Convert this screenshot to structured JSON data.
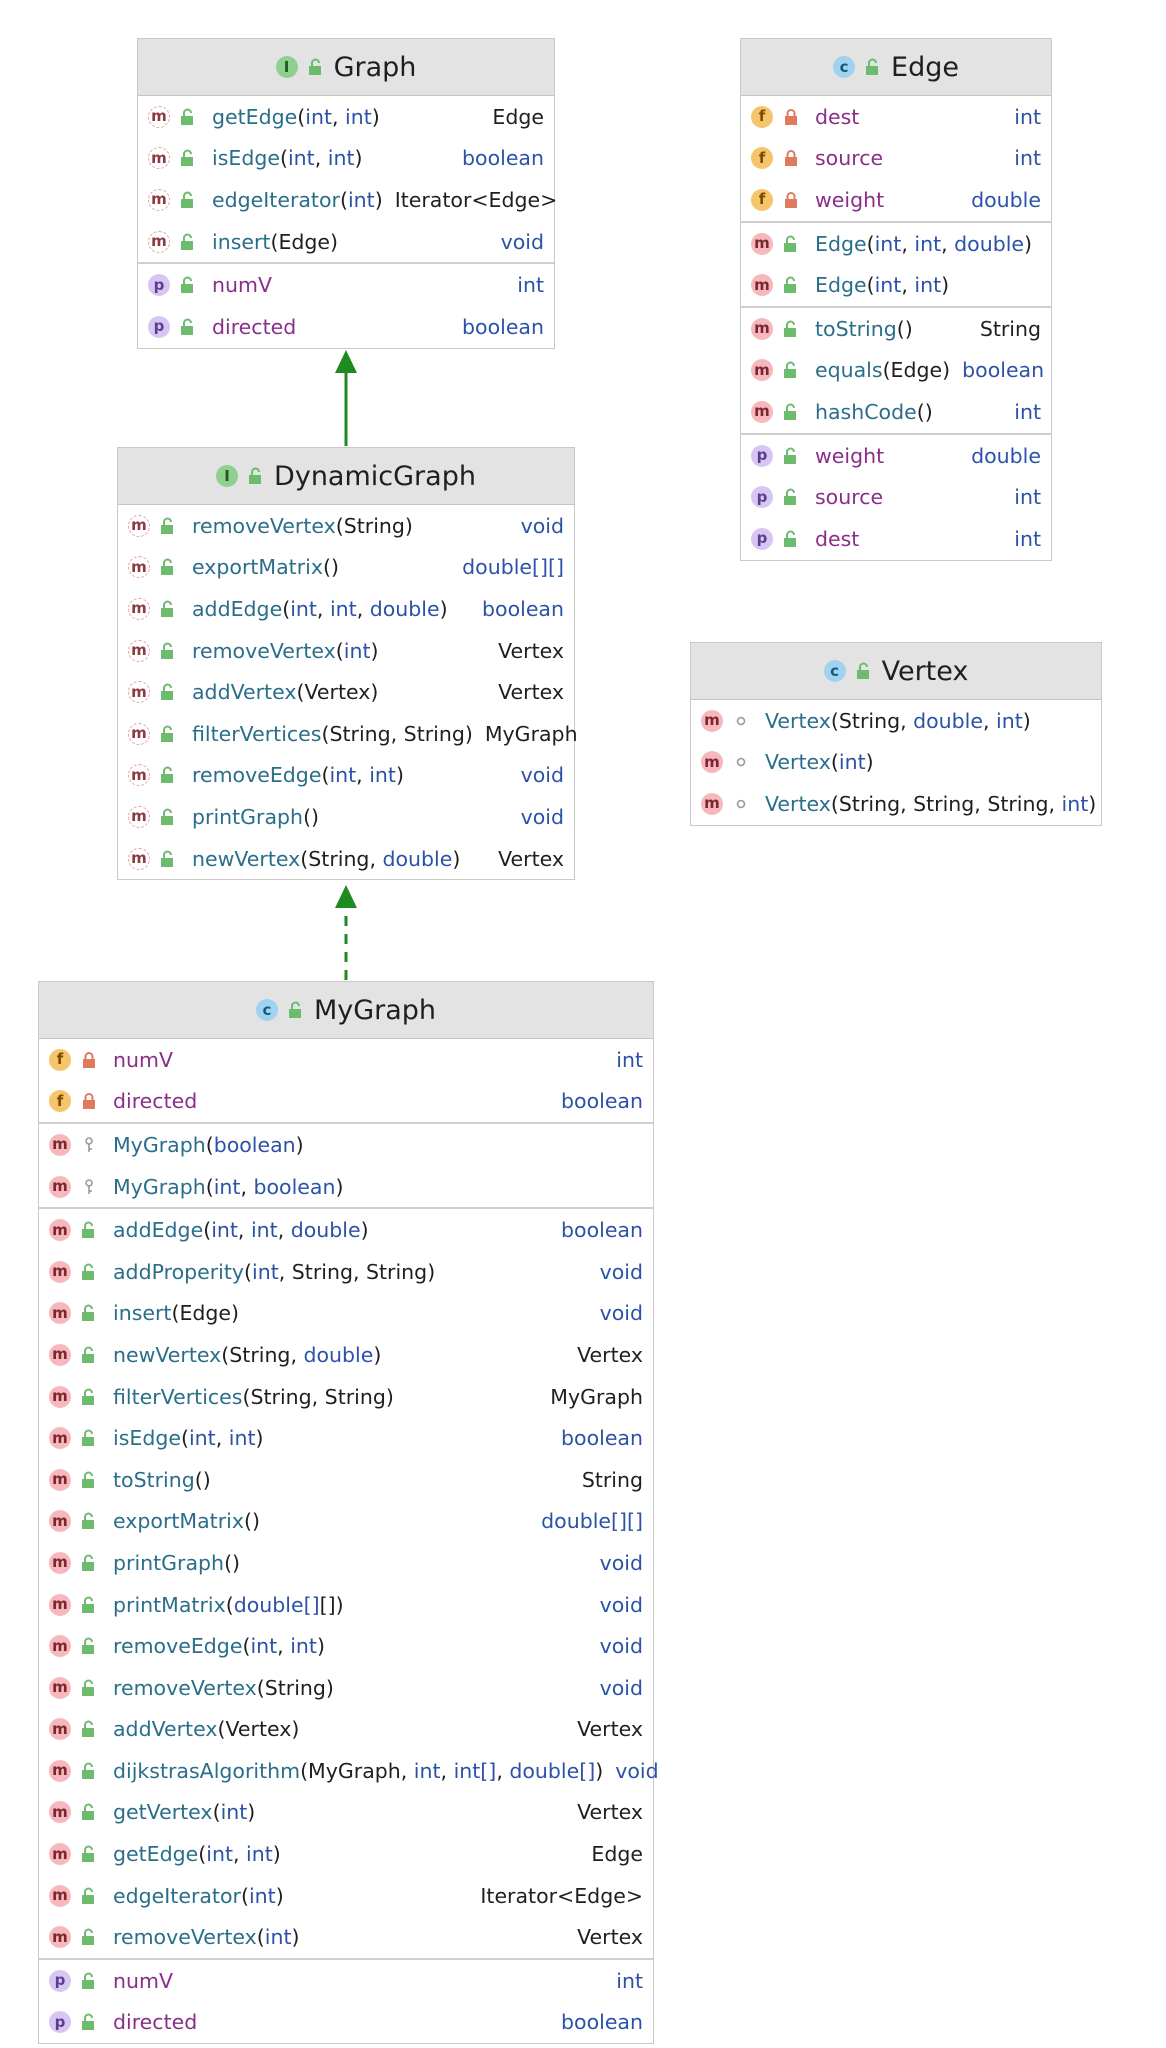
{
  "colors": {
    "header_bg": "#e3e3e3",
    "method_badge": "#f7b8bd",
    "field_badge": "#f5c46b",
    "property_badge": "#d7c6f4",
    "class_badge": "#9fd3f0",
    "interface_badge": "#8fd08f",
    "arrow": "#1f8a1f",
    "name_text": "#2a6e8a",
    "property_text": "#8a2e8a",
    "keyword_text": "#2c52a8"
  },
  "icons": {
    "method": "m",
    "field": "f",
    "property": "p",
    "class": "c",
    "interface": "I"
  },
  "graph": {
    "title": "Graph",
    "methods": [
      {
        "name": "getEdge",
        "params": "(int, int)",
        "type": "Edge"
      },
      {
        "name": "isEdge",
        "params": "(int, int)",
        "type": "boolean"
      },
      {
        "name": "edgeIterator",
        "params": "(int)",
        "type": "Iterator<Edge>"
      },
      {
        "name": "insert",
        "params": "(Edge)",
        "type": "void"
      }
    ],
    "properties": [
      {
        "name": "numV",
        "type": "int"
      },
      {
        "name": "directed",
        "type": "boolean"
      }
    ]
  },
  "edge": {
    "title": "Edge",
    "fields": [
      {
        "name": "dest",
        "type": "int"
      },
      {
        "name": "source",
        "type": "int"
      },
      {
        "name": "weight",
        "type": "double"
      }
    ],
    "constructors": [
      {
        "name": "Edge",
        "params": "(int, int, double)"
      },
      {
        "name": "Edge",
        "params": "(int, int)"
      }
    ],
    "methods": [
      {
        "name": "toString",
        "params": "()",
        "type": "String"
      },
      {
        "name": "equals",
        "params": "(Edge)",
        "type": "boolean"
      },
      {
        "name": "hashCode",
        "params": "()",
        "type": "int"
      }
    ],
    "properties": [
      {
        "name": "weight",
        "type": "double"
      },
      {
        "name": "source",
        "type": "int"
      },
      {
        "name": "dest",
        "type": "int"
      }
    ]
  },
  "dynamic": {
    "title": "DynamicGraph",
    "methods": [
      {
        "name": "removeVertex",
        "params": "(String)",
        "type": "void"
      },
      {
        "name": "exportMatrix",
        "params": "()",
        "type": "double[][]"
      },
      {
        "name": "addEdge",
        "params": "(int, int, double)",
        "type": "boolean"
      },
      {
        "name": "removeVertex",
        "params": "(int)",
        "type": "Vertex"
      },
      {
        "name": "addVertex",
        "params": "(Vertex)",
        "type": "Vertex"
      },
      {
        "name": "filterVertices",
        "params": "(String, String)",
        "type": "MyGraph"
      },
      {
        "name": "removeEdge",
        "params": "(int, int)",
        "type": "void"
      },
      {
        "name": "printGraph",
        "params": "()",
        "type": "void"
      },
      {
        "name": "newVertex",
        "params": "(String, double)",
        "type": "Vertex"
      }
    ]
  },
  "vertex": {
    "title": "Vertex",
    "constructors": [
      {
        "name": "Vertex",
        "params": "(String, double, int)"
      },
      {
        "name": "Vertex",
        "params": "(int)"
      },
      {
        "name": "Vertex",
        "params": "(String, String, String, int)"
      }
    ]
  },
  "mygraph": {
    "title": "MyGraph",
    "fields": [
      {
        "name": "numV",
        "type": "int"
      },
      {
        "name": "directed",
        "type": "boolean"
      }
    ],
    "constructors": [
      {
        "name": "MyGraph",
        "params": "(boolean)"
      },
      {
        "name": "MyGraph",
        "params": "(int, boolean)"
      }
    ],
    "methods": [
      {
        "name": "addEdge",
        "params": "(int, int, double)",
        "type": "boolean"
      },
      {
        "name": "addProperity",
        "params": "(int, String, String)",
        "type": "void"
      },
      {
        "name": "insert",
        "params": "(Edge)",
        "type": "void"
      },
      {
        "name": "newVertex",
        "params": "(String, double)",
        "type": "Vertex"
      },
      {
        "name": "filterVertices",
        "params": "(String, String)",
        "type": "MyGraph"
      },
      {
        "name": "isEdge",
        "params": "(int, int)",
        "type": "boolean"
      },
      {
        "name": "toString",
        "params": "()",
        "type": "String"
      },
      {
        "name": "exportMatrix",
        "params": "()",
        "type": "double[][]"
      },
      {
        "name": "printGraph",
        "params": "()",
        "type": "void"
      },
      {
        "name": "printMatrix",
        "params": "(double[][])",
        "type": "void"
      },
      {
        "name": "removeEdge",
        "params": "(int, int)",
        "type": "void"
      },
      {
        "name": "removeVertex",
        "params": "(String)",
        "type": "void"
      },
      {
        "name": "addVertex",
        "params": "(Vertex)",
        "type": "Vertex"
      },
      {
        "name": "dijkstrasAlgorithm",
        "params": "(MyGraph, int, int[], double[])",
        "type": "void"
      },
      {
        "name": "getVertex",
        "params": "(int)",
        "type": "Vertex"
      },
      {
        "name": "getEdge",
        "params": "(int, int)",
        "type": "Edge"
      },
      {
        "name": "edgeIterator",
        "params": "(int)",
        "type": "Iterator<Edge>"
      },
      {
        "name": "removeVertex",
        "params": "(int)",
        "type": "Vertex"
      }
    ],
    "properties": [
      {
        "name": "numV",
        "type": "int"
      },
      {
        "name": "directed",
        "type": "boolean"
      }
    ]
  }
}
